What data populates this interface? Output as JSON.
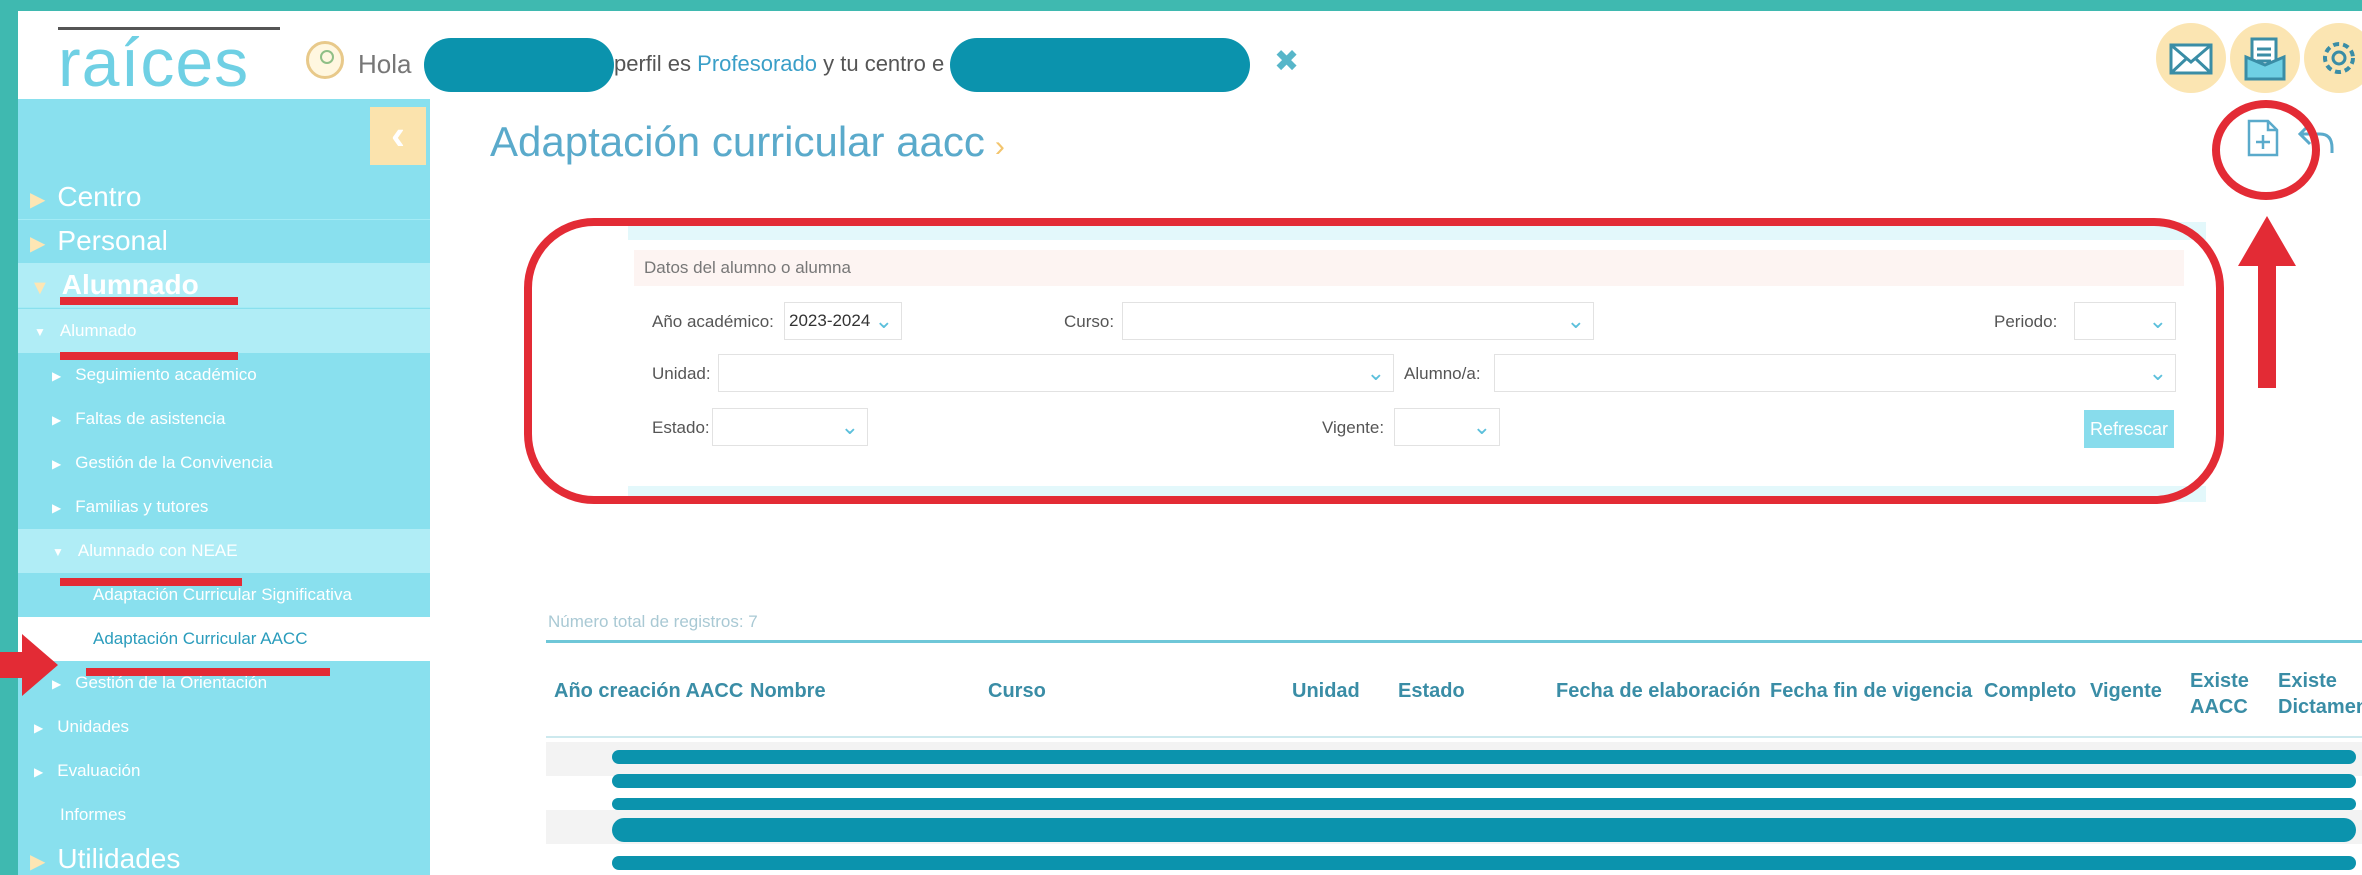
{
  "header": {
    "logo": "raíces",
    "greeting": "Hola",
    "role_prefix": "perfil es ",
    "role": "Profesorado",
    "center_prefix": " y tu centro e",
    "close_icon": "close-icon",
    "icons": [
      "mail-icon",
      "document-icon",
      "gear-icon"
    ]
  },
  "sidebar": {
    "collapse_icon": "chevron-left-icon",
    "items": [
      {
        "label": "Centro"
      },
      {
        "label": "Personal"
      },
      {
        "label": "Alumnado"
      },
      {
        "label": "Alumnado"
      },
      {
        "label": "Seguimiento académico"
      },
      {
        "label": "Faltas de asistencia"
      },
      {
        "label": "Gestión de la Convivencia"
      },
      {
        "label": "Familias y tutores"
      },
      {
        "label": "Alumnado con NEAE"
      },
      {
        "label": "Adaptación Curricular Significativa"
      },
      {
        "label": "Adaptación Curricular AACC"
      },
      {
        "label": "Gestión de la Orientación"
      },
      {
        "label": "Unidades"
      },
      {
        "label": "Evaluación"
      },
      {
        "label": "Informes"
      },
      {
        "label": "Utilidades"
      }
    ]
  },
  "page": {
    "title": "Adaptación curricular aacc",
    "chevron": "›"
  },
  "filters": {
    "section_title": "Datos del alumno o alumna",
    "year_label": "Año académico:",
    "year_value": "2023-2024",
    "course_label": "Curso:",
    "course_value": "",
    "period_label": "Periodo:",
    "period_value": "",
    "unit_label": "Unidad:",
    "unit_value": "",
    "student_label": "Alumno/a:",
    "student_value": "",
    "status_label": "Estado:",
    "status_value": "",
    "current_label": "Vigente:",
    "current_value": "",
    "refresh_label": "Refrescar"
  },
  "table": {
    "count_text": "Número total de registros: 7",
    "headers": [
      "Año creación AACC",
      "Nombre",
      "Curso",
      "Unidad",
      "Estado",
      "Fecha de elaboración",
      "Fecha fin de vigencia",
      "Completo",
      "Vigente",
      "Existe AACC",
      "Existe Dictamen"
    ]
  },
  "colors": {
    "frame": "#3fb9b0",
    "sidebar": "#89e0ee",
    "accent": "#5aaacb",
    "annotation": "#e32b35",
    "redaction": "#0b93ad"
  }
}
